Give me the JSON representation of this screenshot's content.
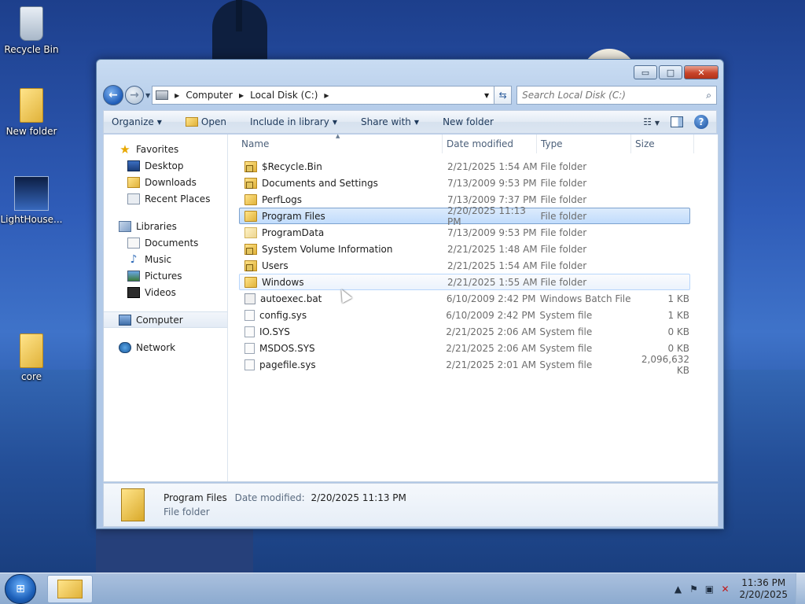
{
  "desktop": {
    "icons": [
      {
        "label": "Recycle Bin",
        "icon": "recycle-bin-icon"
      },
      {
        "label": "New folder",
        "icon": "folder-icon"
      },
      {
        "label": "LightHouse...",
        "icon": "image-icon"
      },
      {
        "label": "core",
        "icon": "folder-icon"
      }
    ]
  },
  "window": {
    "buttons": {
      "minimize": "▭",
      "maximize": "□",
      "close": "✕"
    },
    "address": {
      "crumbs": [
        "Computer",
        "Local Disk (C:)"
      ]
    },
    "search": {
      "placeholder": "Search Local Disk (C:)"
    },
    "toolbar": {
      "organize": "Organize",
      "open": "Open",
      "include_in_library": "Include in library",
      "share_with": "Share with",
      "new_folder": "New folder"
    },
    "nav": {
      "favorites": "Favorites",
      "favorites_items": [
        "Desktop",
        "Downloads",
        "Recent Places"
      ],
      "libraries": "Libraries",
      "libraries_items": [
        "Documents",
        "Music",
        "Pictures",
        "Videos"
      ],
      "computer": "Computer",
      "network": "Network"
    },
    "columns": {
      "name": "Name",
      "date": "Date modified",
      "type": "Type",
      "size": "Size"
    },
    "files": [
      {
        "name": "$Recycle.Bin",
        "date": "2/21/2025 1:54 AM",
        "type": "File folder",
        "size": ""
      },
      {
        "name": "Documents and Settings",
        "date": "7/13/2009 9:53 PM",
        "type": "File folder",
        "size": ""
      },
      {
        "name": "PerfLogs",
        "date": "7/13/2009 7:37 PM",
        "type": "File folder",
        "size": ""
      },
      {
        "name": "Program Files",
        "date": "2/20/2025 11:13 PM",
        "type": "File folder",
        "size": ""
      },
      {
        "name": "ProgramData",
        "date": "7/13/2009 9:53 PM",
        "type": "File folder",
        "size": ""
      },
      {
        "name": "System Volume Information",
        "date": "2/21/2025 1:48 AM",
        "type": "File folder",
        "size": ""
      },
      {
        "name": "Users",
        "date": "2/21/2025 1:54 AM",
        "type": "File folder",
        "size": ""
      },
      {
        "name": "Windows",
        "date": "2/21/2025 1:55 AM",
        "type": "File folder",
        "size": ""
      },
      {
        "name": "autoexec.bat",
        "date": "6/10/2009 2:42 PM",
        "type": "Windows Batch File",
        "size": "1 KB"
      },
      {
        "name": "config.sys",
        "date": "6/10/2009 2:42 PM",
        "type": "System file",
        "size": "1 KB"
      },
      {
        "name": "IO.SYS",
        "date": "2/21/2025 2:06 AM",
        "type": "System file",
        "size": "0 KB"
      },
      {
        "name": "MSDOS.SYS",
        "date": "2/21/2025 2:06 AM",
        "type": "System file",
        "size": "0 KB"
      },
      {
        "name": "pagefile.sys",
        "date": "2/21/2025 2:01 AM",
        "type": "System file",
        "size": "2,096,632 KB"
      }
    ],
    "details": {
      "name": "Program Files",
      "date_label": "Date modified:",
      "date_value": "2/20/2025 11:13 PM",
      "type": "File folder"
    }
  },
  "taskbar": {
    "clock_time": "11:36 PM",
    "clock_date": "2/20/2025"
  }
}
